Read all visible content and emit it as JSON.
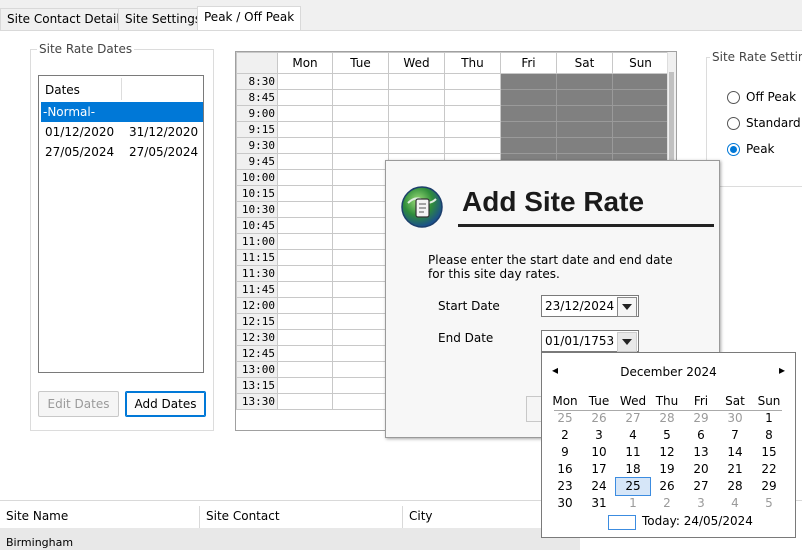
{
  "tabs": [
    "Site Contact Details",
    "Site Settings",
    "Peak / Off Peak"
  ],
  "rate_dates": {
    "title": "Site Rate Dates",
    "header": "Dates",
    "rows": [
      {
        "start": "-Normal-",
        "end": "",
        "selected": true
      },
      {
        "start": "01/12/2020",
        "end": "31/12/2020",
        "selected": false
      },
      {
        "start": "27/05/2024",
        "end": "27/05/2024",
        "selected": false
      }
    ],
    "edit_button": "Edit Dates",
    "add_button": "Add Dates"
  },
  "schedule": {
    "days": [
      "Mon",
      "Tue",
      "Wed",
      "Thu",
      "Fri",
      "Sat",
      "Sun"
    ],
    "times": [
      "8:30",
      "8:45",
      "9:00",
      "9:15",
      "9:30",
      "9:45",
      "10:00",
      "10:15",
      "10:30",
      "10:45",
      "11:00",
      "11:15",
      "11:30",
      "11:45",
      "12:00",
      "12:15",
      "12:30",
      "12:45",
      "13:00",
      "13:15",
      "13:30"
    ],
    "peak_days": [
      "Fri",
      "Sat",
      "Sun"
    ],
    "peak_color": "#808080"
  },
  "rate_setting": {
    "title": "Site Rate Setting",
    "options": [
      "Off Peak",
      "Standard",
      "Peak"
    ],
    "selected": "Peak"
  },
  "dialog": {
    "title": "Add Site Rate",
    "message": "Please enter the start date and end date for this site day rates.",
    "start_label": "Start Date",
    "start_value": "23/12/2024",
    "end_label": "End Date",
    "end_value": "01/01/1753"
  },
  "calendar": {
    "month": "December 2024",
    "weekdays": [
      "Mon",
      "Tue",
      "Wed",
      "Thu",
      "Fri",
      "Sat",
      "Sun"
    ],
    "weeks": [
      [
        [
          "25",
          1
        ],
        [
          "26",
          1
        ],
        [
          "27",
          1
        ],
        [
          "28",
          1
        ],
        [
          "29",
          1
        ],
        [
          "30",
          1
        ],
        [
          "1",
          0
        ]
      ],
      [
        [
          "2",
          0
        ],
        [
          "3",
          0
        ],
        [
          "4",
          0
        ],
        [
          "5",
          0
        ],
        [
          "6",
          0
        ],
        [
          "7",
          0
        ],
        [
          "8",
          0
        ]
      ],
      [
        [
          "9",
          0
        ],
        [
          "10",
          0
        ],
        [
          "11",
          0
        ],
        [
          "12",
          0
        ],
        [
          "13",
          0
        ],
        [
          "14",
          0
        ],
        [
          "15",
          0
        ]
      ],
      [
        [
          "16",
          0
        ],
        [
          "17",
          0
        ],
        [
          "18",
          0
        ],
        [
          "19",
          0
        ],
        [
          "20",
          0
        ],
        [
          "21",
          0
        ],
        [
          "22",
          0
        ]
      ],
      [
        [
          "23",
          0
        ],
        [
          "24",
          0
        ],
        [
          "25",
          2
        ],
        [
          "26",
          0
        ],
        [
          "27",
          0
        ],
        [
          "28",
          0
        ],
        [
          "29",
          0
        ]
      ],
      [
        [
          "30",
          0
        ],
        [
          "31",
          0
        ],
        [
          "1",
          1
        ],
        [
          "2",
          1
        ],
        [
          "3",
          1
        ],
        [
          "4",
          1
        ],
        [
          "5",
          1
        ]
      ]
    ],
    "today_label": "Today: 24/05/2024",
    "accent": "#3c8ce0"
  },
  "bottom_list": {
    "columns": [
      "Site Name",
      "Site Contact",
      "City"
    ],
    "first_row": "Birmingham"
  }
}
